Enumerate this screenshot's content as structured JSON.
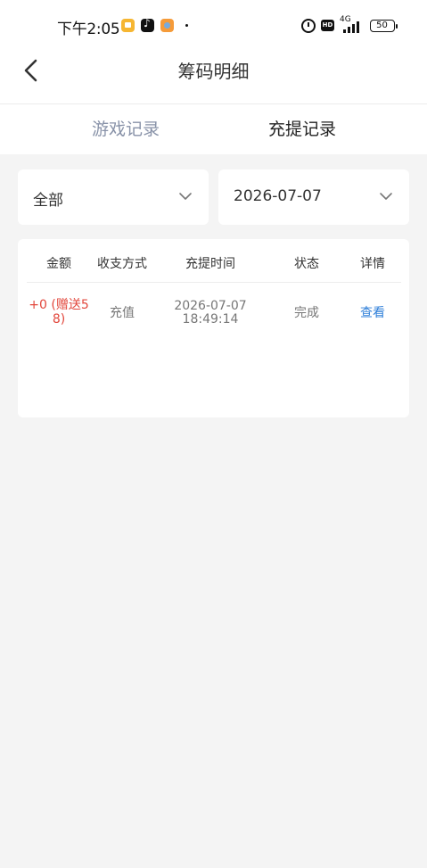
{
  "status_bar": {
    "time": "下午2:05",
    "network": "4G",
    "battery": "50"
  },
  "header": {
    "title": "筹码明细"
  },
  "tabs": [
    {
      "label": "游戏记录",
      "active": false
    },
    {
      "label": "充提记录",
      "active": true
    }
  ],
  "filters": {
    "type_value": "全部",
    "date_value": "2026-07-07"
  },
  "table": {
    "columns": [
      "金额",
      "收支方式",
      "充提时间",
      "状态",
      "详情"
    ],
    "rows": [
      {
        "amount_line1": "+0 (赠送5",
        "amount_line2": "8)",
        "method": "充值",
        "date": "2026-07-07",
        "time": "18:49:14",
        "status": "完成",
        "detail": "查看"
      }
    ]
  },
  "colors": {
    "accent_blue": "#2f7fd9",
    "amount_red": "#e2473c",
    "inactive_tab": "#8892a8",
    "background": "#f4f4f4"
  }
}
